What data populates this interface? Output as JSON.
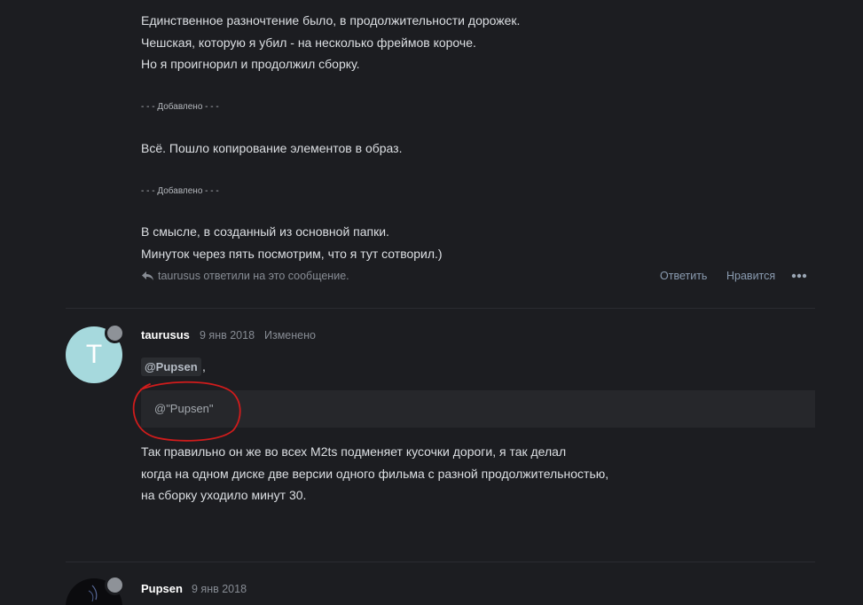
{
  "post1": {
    "lines": [
      "Единственное разночтение было, в продолжительности дорожек.",
      "Чешская, которую я убил - на несколько фреймов короче.",
      "Но я проигнорил и продолжил сборку."
    ],
    "separator_1": "- - - Добавлено - - -",
    "line_after_1": "Всё. Пошло копирование элементов в образ.",
    "separator_2": "- - - Добавлено - - -",
    "lines_after_2": [
      "В смысле, в созданный из основной папки.",
      "Минуток через пять посмотрим, что я тут сотворил.)"
    ],
    "reply_note": "taurusus ответили на это сообщение.",
    "actions": {
      "reply": "Ответить",
      "like": "Нравится",
      "more_icon": "ellipsis-icon"
    }
  },
  "post2": {
    "avatar_letter": "T",
    "author": "taurusus",
    "date": "9 янв 2018",
    "edited": "Изменено",
    "mention": "@Pupsen",
    "comma": ",",
    "quote": "@\"Pupsen\"",
    "annotation_color": "#d01c1c",
    "body": [
      "Так правильно он же во всех M2ts подменяет кусочки дороги, я так делал",
      "когда на одном диске две версии одного фильма с разной продолжительностью,",
      "на сборку уходило минут 30."
    ]
  },
  "post3": {
    "author": "Pupsen",
    "date": "9 янв 2018"
  },
  "colors": {
    "background": "#1c1d21",
    "text": "#dcdfe3",
    "muted": "#878c94",
    "link": "#8a9bb0",
    "avatar_t": "#a6d9dd",
    "quote_bg": "#26272b"
  }
}
